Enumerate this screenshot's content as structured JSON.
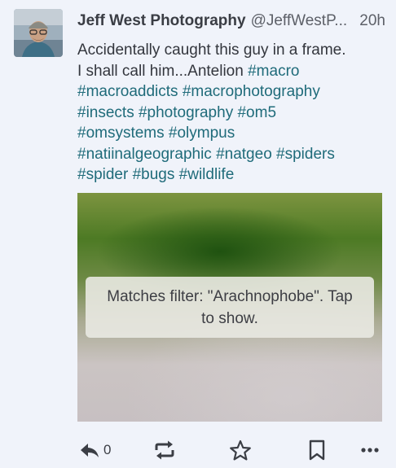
{
  "post": {
    "display_name": "Jeff West Photography",
    "handle": "@JeffWestP...",
    "time": "20h",
    "text_intro": "Accidentally caught this guy in a frame.",
    "text_line2": "I shall call him...Antelion",
    "hashtags": [
      "#macro",
      "#macroaddicts",
      "#macrophotography",
      "#insects",
      "#photography",
      "#om5",
      "#omsystems",
      "#olympus",
      "#natiinalgeographic",
      "#natgeo",
      "#spiders",
      "#spider",
      "#bugs",
      "#wildlife"
    ],
    "filter_message": "Matches filter: \"Arachnophobe\". Tap to show."
  },
  "actions": {
    "reply_count": "0",
    "icons": [
      "reply-icon",
      "boost-icon",
      "star-icon",
      "bookmark-icon",
      "more-icon"
    ]
  },
  "colors": {
    "background": "#f0f3fa",
    "hashtag": "#1f6b7a",
    "text": "#33363d"
  }
}
